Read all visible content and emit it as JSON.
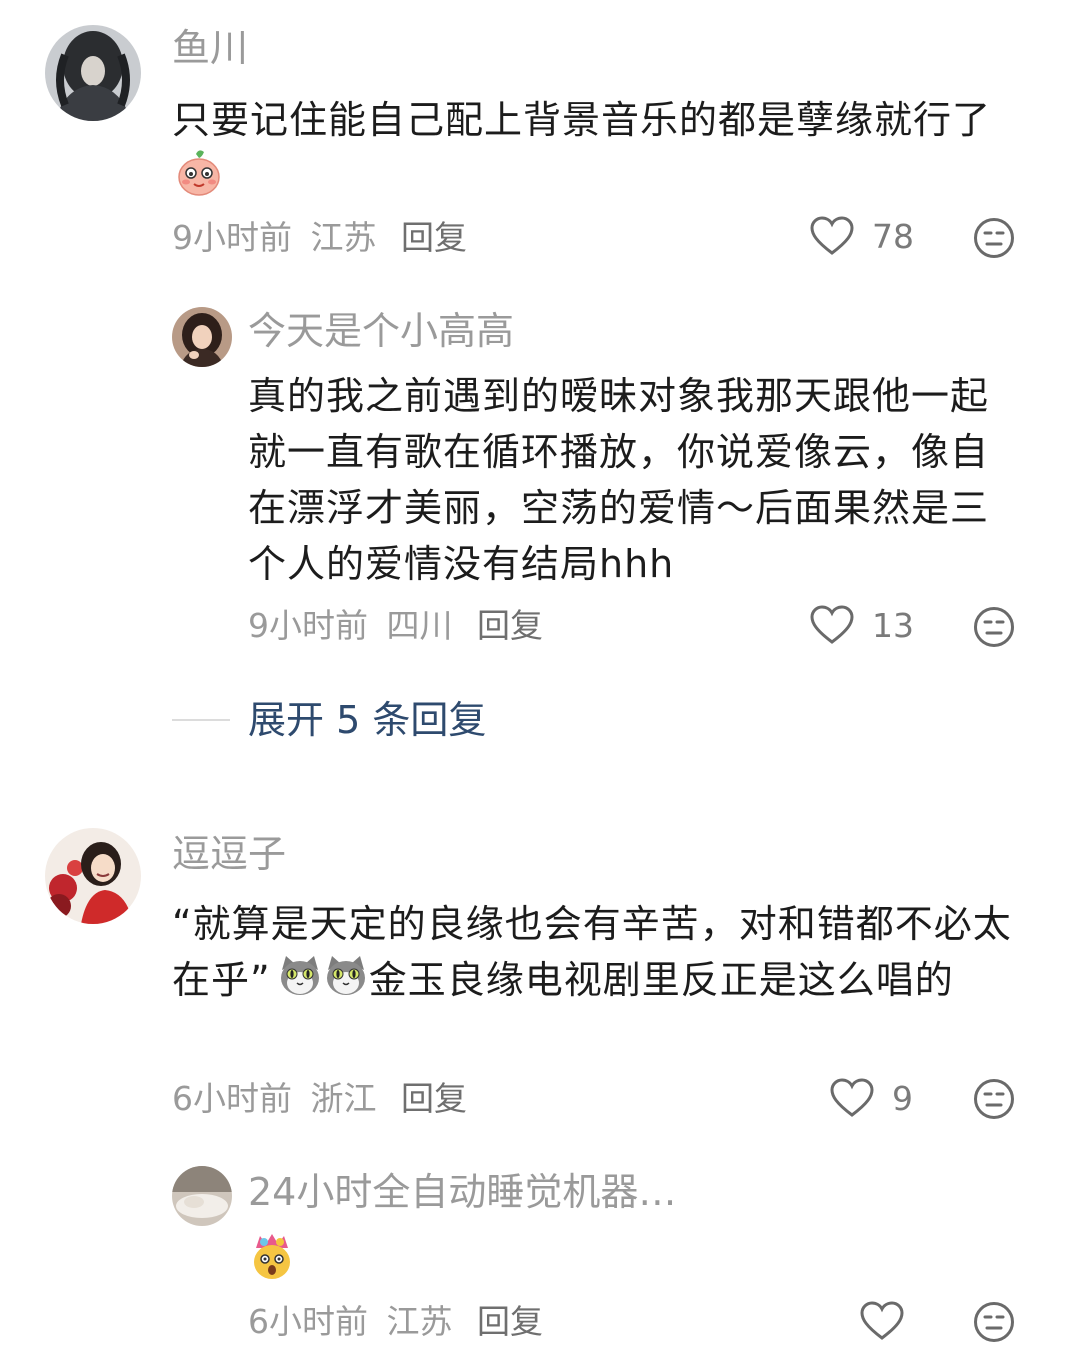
{
  "comments": [
    {
      "user": "鱼川",
      "text_before": "只要记住能自己配上背景音乐的都是孽缘就行了",
      "emoji": "peach-face-emoji",
      "time": "9小时前",
      "location": "江苏",
      "reply_label": "回复",
      "likes": "78"
    },
    {
      "user": "今天是个小高高",
      "text": "真的我之前遇到的暧昧对象我那天跟他一起就一直有歌在循环播放，你说爱像云，像自在漂浮才美丽，空荡的爱情～后面果然是三个人的爱情没有结局hhh",
      "time": "9小时前",
      "location": "四川",
      "reply_label": "回复",
      "likes": "13"
    },
    {
      "user": "逗逗子",
      "text_before": "“就算是天定的良缘也会有辛苦，对和错都不必太在乎”",
      "emoji": "cat-face-emoji",
      "text_after": "金玉良缘电视剧里反正是这么唱的",
      "time": "6小时前",
      "location": "浙江",
      "reply_label": "回复",
      "likes": "9"
    },
    {
      "user": "24小时全自动睡觉机器…",
      "emoji": "exploding-head-emoji",
      "time": "6小时前",
      "location": "江苏",
      "reply_label": "回复",
      "likes": ""
    }
  ],
  "expand_replies": "展开 5 条回复",
  "colors": {
    "name": "#9a9a9a",
    "text": "#1c1c1c",
    "meta": "#9a9a9a",
    "expand": "#2e4a6e"
  }
}
